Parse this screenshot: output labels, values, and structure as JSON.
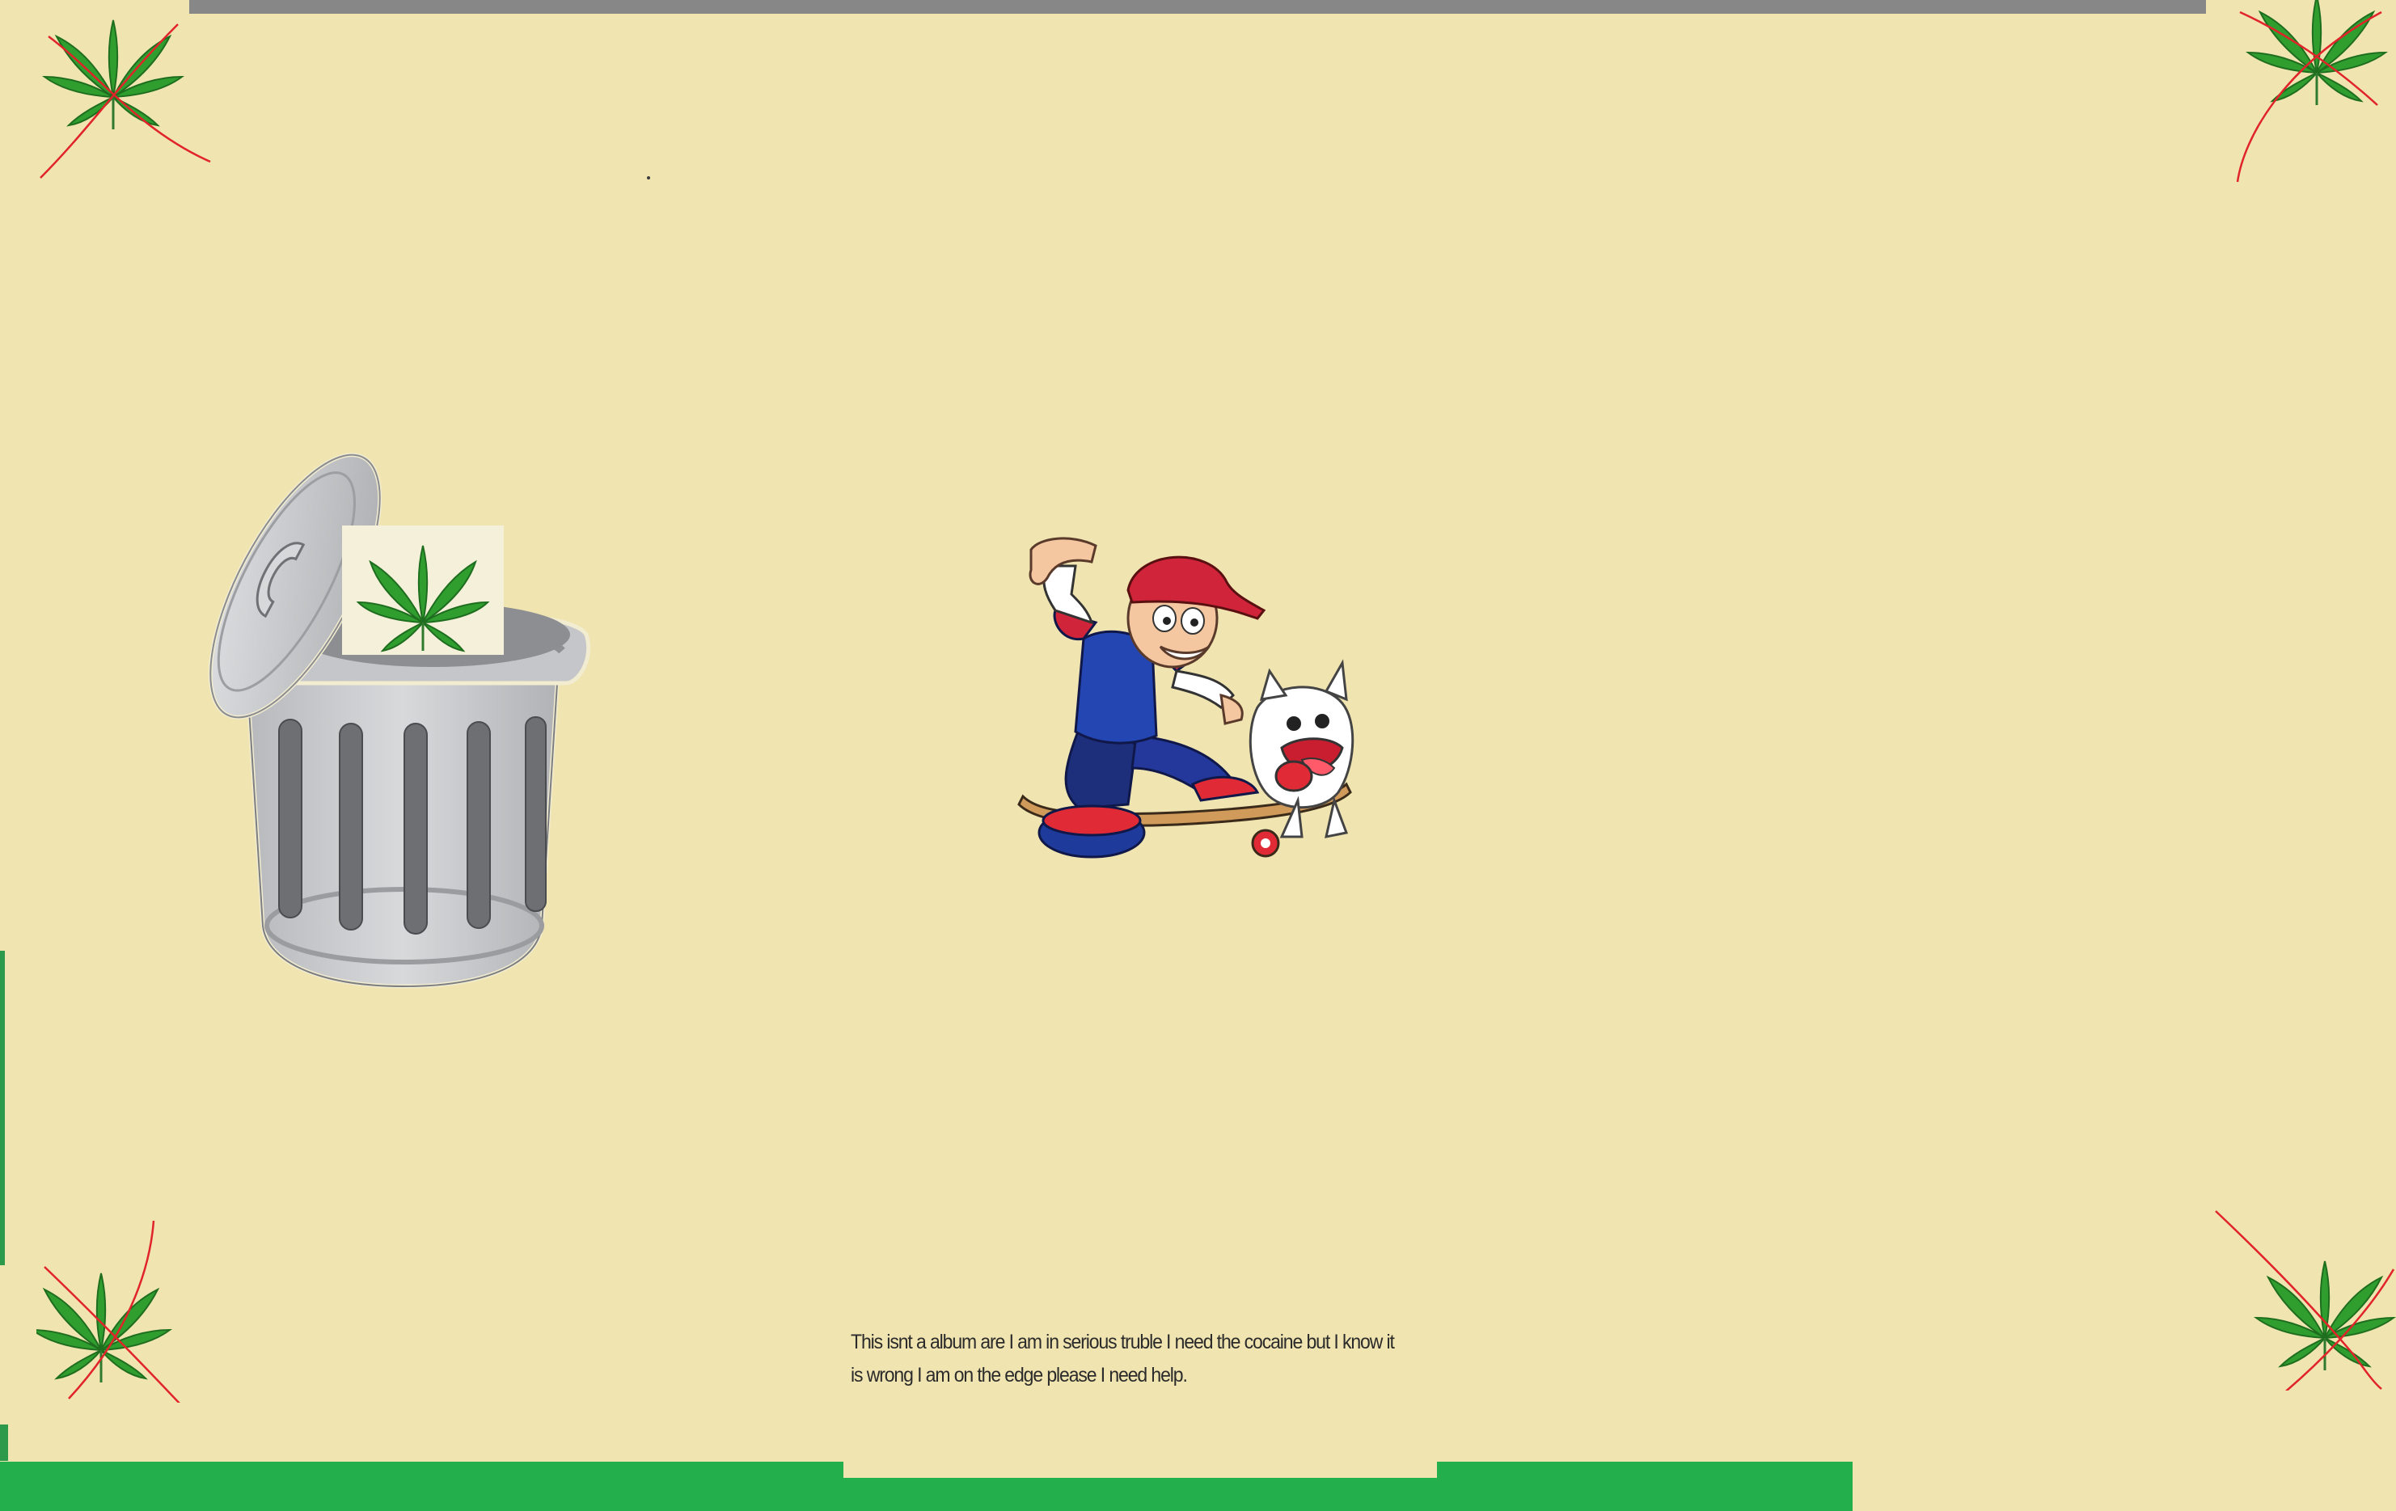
{
  "caption": {
    "text": "This isnt a album are I am in serious truble I need the cocaine but I know it is wrong I am on the edge please I need help."
  },
  "icons": {
    "corner_top_left": "crossed-out-cannabis-leaf-icon",
    "corner_top_right": "crossed-out-cannabis-leaf-icon",
    "corner_bottom_left": "crossed-out-cannabis-leaf-icon",
    "corner_bottom_right": "crossed-out-cannabis-leaf-icon",
    "trash": "trash-can-with-leaf-illustration",
    "character": "skateboarder-boy-with-bulldog-illustration"
  },
  "colors": {
    "background": "#f0e4b0",
    "top_bar": "#878787",
    "bottom_bar": "#23b04c",
    "cross_line": "#e0242a",
    "leaf": "#2f9e2f"
  }
}
